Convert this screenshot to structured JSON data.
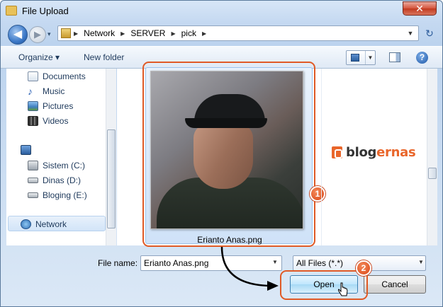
{
  "window": {
    "title": "File Upload",
    "close_glyph": "✕"
  },
  "nav_buttons": {
    "back": "◀",
    "forward": "▶",
    "recent": "▾",
    "refresh": "↻"
  },
  "address": {
    "crumbs": [
      "Network",
      "SERVER",
      "pick"
    ],
    "separator": "▶",
    "dropdown": "▼"
  },
  "toolbar": {
    "organize": "Organize ▾",
    "new_folder": "New folder",
    "help": "?",
    "view_dropdown": "▼"
  },
  "sidebar": {
    "items": [
      {
        "label": "Documents",
        "icon": "document-icon"
      },
      {
        "label": "Music",
        "icon": "music-icon"
      },
      {
        "label": "Pictures",
        "icon": "pictures-icon"
      },
      {
        "label": "Videos",
        "icon": "videos-icon"
      },
      {
        "label": "",
        "icon": "computer-icon"
      },
      {
        "label": "Sistem (C:)",
        "icon": "drive-icon"
      },
      {
        "label": "Dinas (D:)",
        "icon": "drive-icon"
      },
      {
        "label": "Bloging (E:)",
        "icon": "drive-icon"
      },
      {
        "label": "Network",
        "icon": "network-icon",
        "selected": true
      }
    ]
  },
  "content": {
    "selected_file": "Erianto Anas.png",
    "logo": {
      "part1": "blog",
      "part2": "ernas"
    }
  },
  "annotations": {
    "step1": "1",
    "step2": "2",
    "accent": "#e05a26"
  },
  "footer": {
    "file_name_label": "File name:",
    "file_name_value": "Erianto Anas.png",
    "filter_value": "All Files (*.*)",
    "dropdown": "▼",
    "open_label": "Open",
    "cancel_label": "Cancel"
  }
}
